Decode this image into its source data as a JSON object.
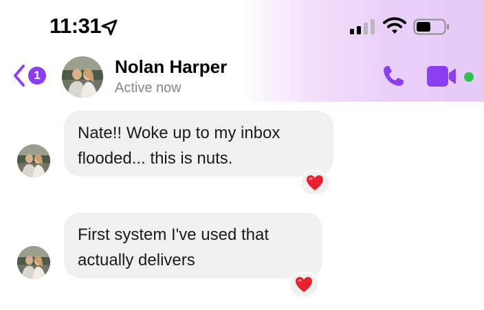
{
  "status_bar": {
    "time": "11:31",
    "location_icon": "location-arrow-icon",
    "signal_icon": "cellular-signal-icon",
    "wifi_icon": "wifi-icon",
    "battery_icon": "battery-icon"
  },
  "header": {
    "back_icon": "chevron-left-icon",
    "unread_badge": "1",
    "contact_name": "Nolan Harper",
    "contact_status": "Active now",
    "call_icon": "phone-icon",
    "video_icon": "video-camera-icon",
    "online": true
  },
  "colors": {
    "accent": "#8b3ef2",
    "bubble_bg": "#f0f0f0",
    "status_gray": "#868686",
    "online_green": "#31c24d",
    "heart_red": "#e8202f"
  },
  "messages": [
    {
      "lines": [
        "Nate!! Woke up to my inbox",
        "flooded... this is nuts."
      ],
      "reaction": "❤️"
    },
    {
      "lines": [
        "First system I've used that",
        "actually delivers"
      ],
      "reaction": "❤️"
    }
  ]
}
